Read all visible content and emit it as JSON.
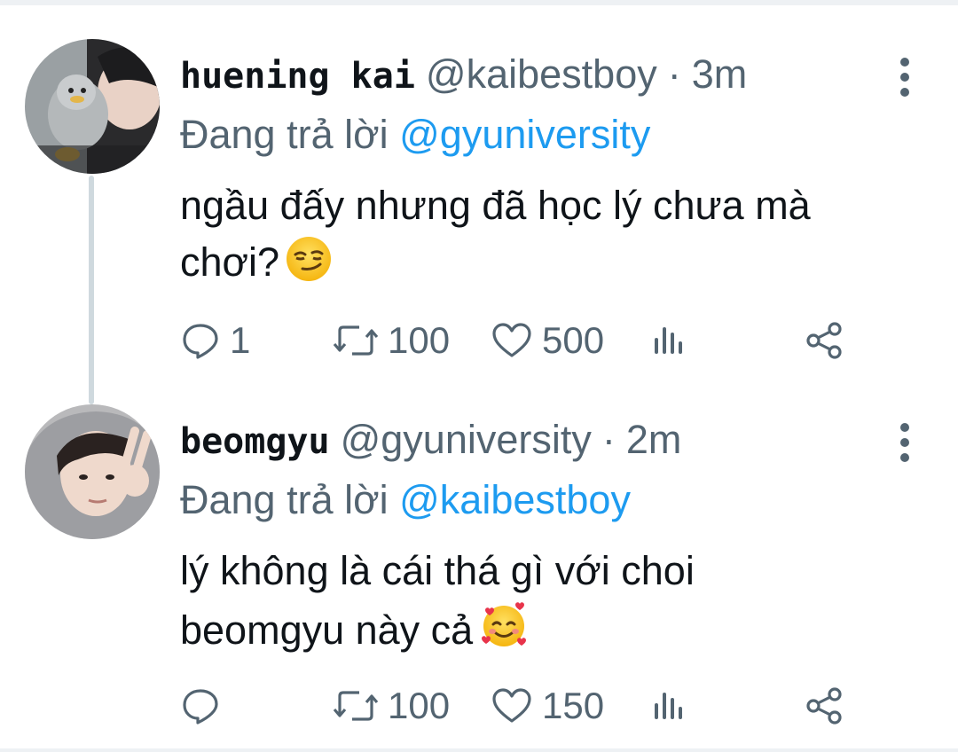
{
  "tweets": [
    {
      "name": "huening kai",
      "handle": "@kaibestboy",
      "separator": "·",
      "time": "3m",
      "reply_prefix": "Đang trả lời",
      "reply_to": "@gyuniversity",
      "text_line1": "ngầu đấy nhưng đã học lý chưa mà",
      "text_line2": "chơi?",
      "emoji": "smirking-face",
      "replies": "1",
      "retweets": "100",
      "likes": "500"
    },
    {
      "name": "beomgyu",
      "handle": "@gyuniversity",
      "separator": "·",
      "time": "2m",
      "reply_prefix": "Đang trả lời",
      "reply_to": "@kaibestboy",
      "text_line1": "lý không là cái thá gì với choi",
      "text_line2": "beomgyu này cả",
      "emoji": "smiling-face-with-hearts",
      "replies": "",
      "retweets": "100",
      "likes": "150"
    }
  ],
  "colors": {
    "text": "#0f1419",
    "secondary": "#536471",
    "link": "#1d9bf0",
    "thread_line": "#cfd9de"
  }
}
